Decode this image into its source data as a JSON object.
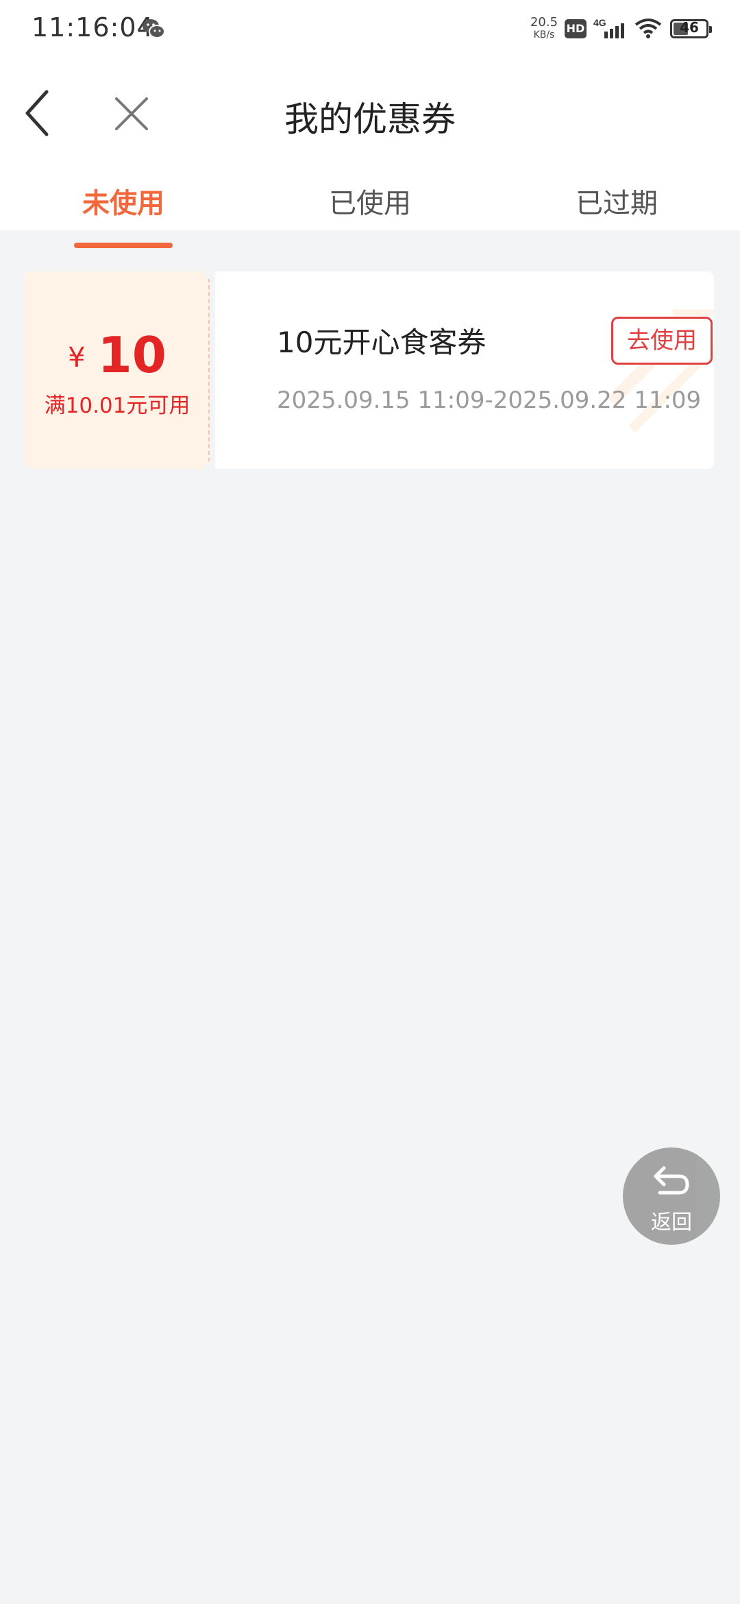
{
  "status_bar": {
    "time": "11:16:04",
    "net_speed_value": "20.5",
    "net_speed_unit": "KB/s",
    "hd_label": "HD",
    "network_label": "4G",
    "battery_level": "46",
    "icons": [
      "wechat-icon",
      "hd-icon",
      "signal-icon",
      "wifi-icon",
      "battery-icon"
    ]
  },
  "header": {
    "title": "我的优惠券",
    "back_icon": "chevron-left-icon",
    "close_icon": "close-icon"
  },
  "tabs": [
    {
      "label": "未使用",
      "active": true
    },
    {
      "label": "已使用",
      "active": false
    },
    {
      "label": "已过期",
      "active": false
    }
  ],
  "coupons": [
    {
      "currency": "¥",
      "amount": "10",
      "threshold": "满10.01元可用",
      "name": "10元开心食客券",
      "validity": "2025.09.15 11:09-2025.09.22 11:09",
      "action_label": "去使用"
    }
  ],
  "floating_button": {
    "label": "返回",
    "icon": "return-arrow-icon"
  },
  "colors": {
    "accent": "#f0683c",
    "coupon_red": "#e32525",
    "coupon_left_bg": "#fff3e8",
    "page_bg": "#f3f4f6"
  }
}
